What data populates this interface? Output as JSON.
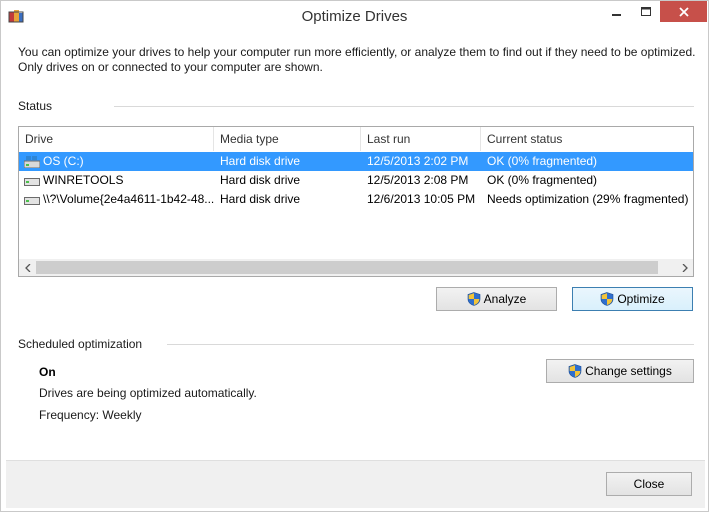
{
  "window": {
    "title": "Optimize Drives"
  },
  "intro": "You can optimize your drives to help your computer run more efficiently, or analyze them to find out if they need to be optimized. Only drives on or connected to your computer are shown.",
  "status": {
    "label": "Status",
    "columns": [
      "Drive",
      "Media type",
      "Last run",
      "Current status"
    ],
    "rows": [
      {
        "drive": "OS (C:)",
        "media": "Hard disk drive",
        "last_run": "12/5/2013 2:02 PM",
        "status": "OK (0% fragmented)",
        "icon": "os-drive-icon",
        "selected": true
      },
      {
        "drive": "WINRETOOLS",
        "media": "Hard disk drive",
        "last_run": "12/5/2013 2:08 PM",
        "status": "OK (0% fragmented)",
        "icon": "hard-drive-icon",
        "selected": false
      },
      {
        "drive": "\\\\?\\Volume{2e4a4611-1b42-48...",
        "media": "Hard disk drive",
        "last_run": "12/6/2013 10:05 PM",
        "status": "Needs optimization (29% fragmented)",
        "icon": "hard-drive-icon",
        "selected": false
      }
    ]
  },
  "actions": {
    "analyze": "Analyze",
    "optimize": "Optimize"
  },
  "scheduled": {
    "label": "Scheduled optimization",
    "state": "On",
    "description": "Drives are being optimized automatically.",
    "frequency": "Frequency: Weekly",
    "change_settings": "Change settings"
  },
  "footer": {
    "close": "Close"
  },
  "colors": {
    "selection": "#3399ff",
    "close_button": "#c7504a",
    "button_focus_border": "#3c7fb1"
  }
}
